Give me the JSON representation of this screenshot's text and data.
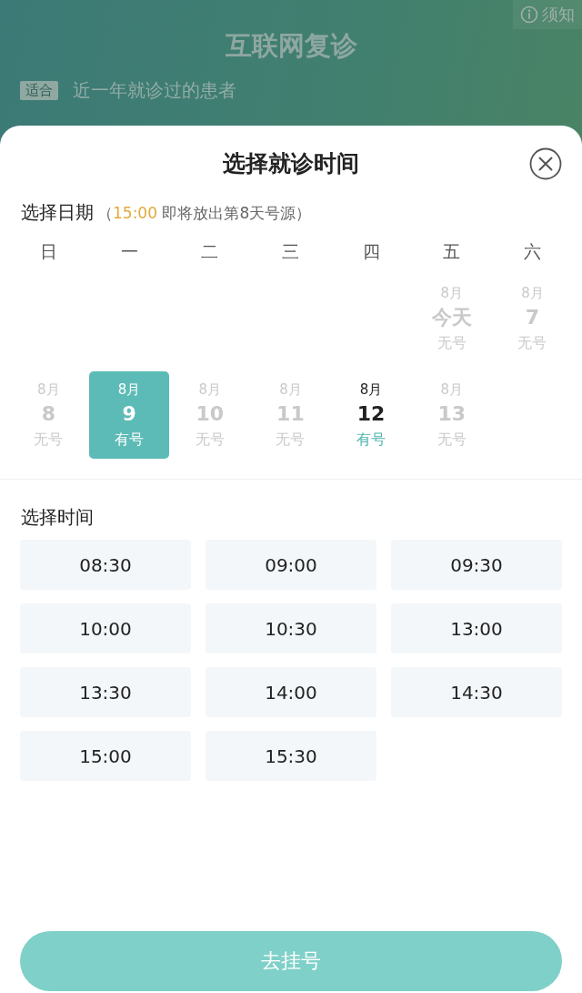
{
  "background_page": {
    "notice_link": "须知",
    "title": "互联网复诊",
    "info_rows": [
      {
        "tag": "适合",
        "text": "近一年就诊过的患者"
      }
    ]
  },
  "sheet": {
    "title": "选择就诊时间",
    "date_section": {
      "heading": "选择日期",
      "note_prefix": "（",
      "release_time": "15:00",
      "note_text": " 即将放出第8天号源",
      "note_suffix": "）",
      "weekdays": [
        "日",
        "一",
        "二",
        "三",
        "四",
        "五",
        "六"
      ],
      "cells": [
        {
          "kind": "blank"
        },
        {
          "kind": "blank"
        },
        {
          "kind": "blank"
        },
        {
          "kind": "blank"
        },
        {
          "kind": "blank"
        },
        {
          "kind": "date",
          "month": "8月",
          "day": "今天",
          "status": "无号",
          "available": false,
          "selected": false
        },
        {
          "kind": "date",
          "month": "8月",
          "day": "7",
          "status": "无号",
          "available": false,
          "selected": false
        },
        {
          "kind": "date",
          "month": "8月",
          "day": "8",
          "status": "无号",
          "available": false,
          "selected": false
        },
        {
          "kind": "date",
          "month": "8月",
          "day": "9",
          "status": "有号",
          "available": true,
          "selected": true
        },
        {
          "kind": "date",
          "month": "8月",
          "day": "10",
          "status": "无号",
          "available": false,
          "selected": false
        },
        {
          "kind": "date",
          "month": "8月",
          "day": "11",
          "status": "无号",
          "available": false,
          "selected": false
        },
        {
          "kind": "date",
          "month": "8月",
          "day": "12",
          "status": "有号",
          "available": true,
          "selected": false
        },
        {
          "kind": "date",
          "month": "8月",
          "day": "13",
          "status": "无号",
          "available": false,
          "selected": false
        }
      ]
    },
    "time_section": {
      "heading": "选择时间",
      "slots": [
        "08:30",
        "09:00",
        "09:30",
        "10:00",
        "10:30",
        "13:00",
        "13:30",
        "14:00",
        "14:30",
        "15:00",
        "15:30"
      ]
    },
    "submit_button": "去挂号"
  }
}
